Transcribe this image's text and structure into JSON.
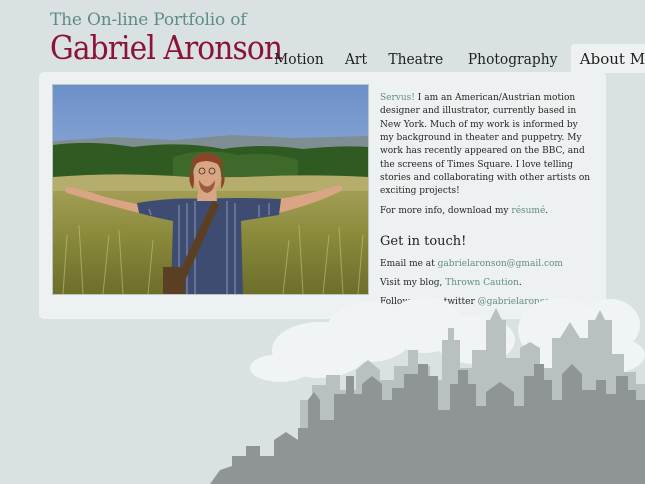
{
  "header": {
    "tagline": "The On-line Portfolio of",
    "name": "Gabriel Aronson"
  },
  "nav": {
    "items": [
      {
        "label": "Motion"
      },
      {
        "label": "Art"
      },
      {
        "label": "Theatre"
      },
      {
        "label": "Photography"
      },
      {
        "label": "About Me"
      }
    ],
    "active_index": 4
  },
  "about": {
    "greeting": "Servus!",
    "bio": "I am an American/Austrian motion designer and illustrator, currently based in New York. Much of my work is informed by my background in theater and puppetry. My work has recently appeared on the BBC, and the screens of Times Square. I love telling stories and collaborating with other artists on exciting projects!",
    "more_info_prefix": "For more info, download my",
    "resume_link": "résumé",
    "resume_suffix": "."
  },
  "contact": {
    "heading": "Get in touch!",
    "email_prefix": "Email me at",
    "email": "gabrielaronson@gmail.com",
    "blog_prefix": "Visit my blog,",
    "blog_link": "Thrown Caution",
    "blog_suffix": ".",
    "twitter_prefix": "Follow me on twitter",
    "twitter_handle": "@gabrielaronson"
  },
  "colors": {
    "background": "#d9e1e2",
    "panel": "#eef1f1",
    "name": "#8d1237",
    "accent": "#5f8d84",
    "skyline_dark": "#8f9595",
    "skyline_light": "#b9c0c0",
    "cloud": "#f1f4f4"
  }
}
